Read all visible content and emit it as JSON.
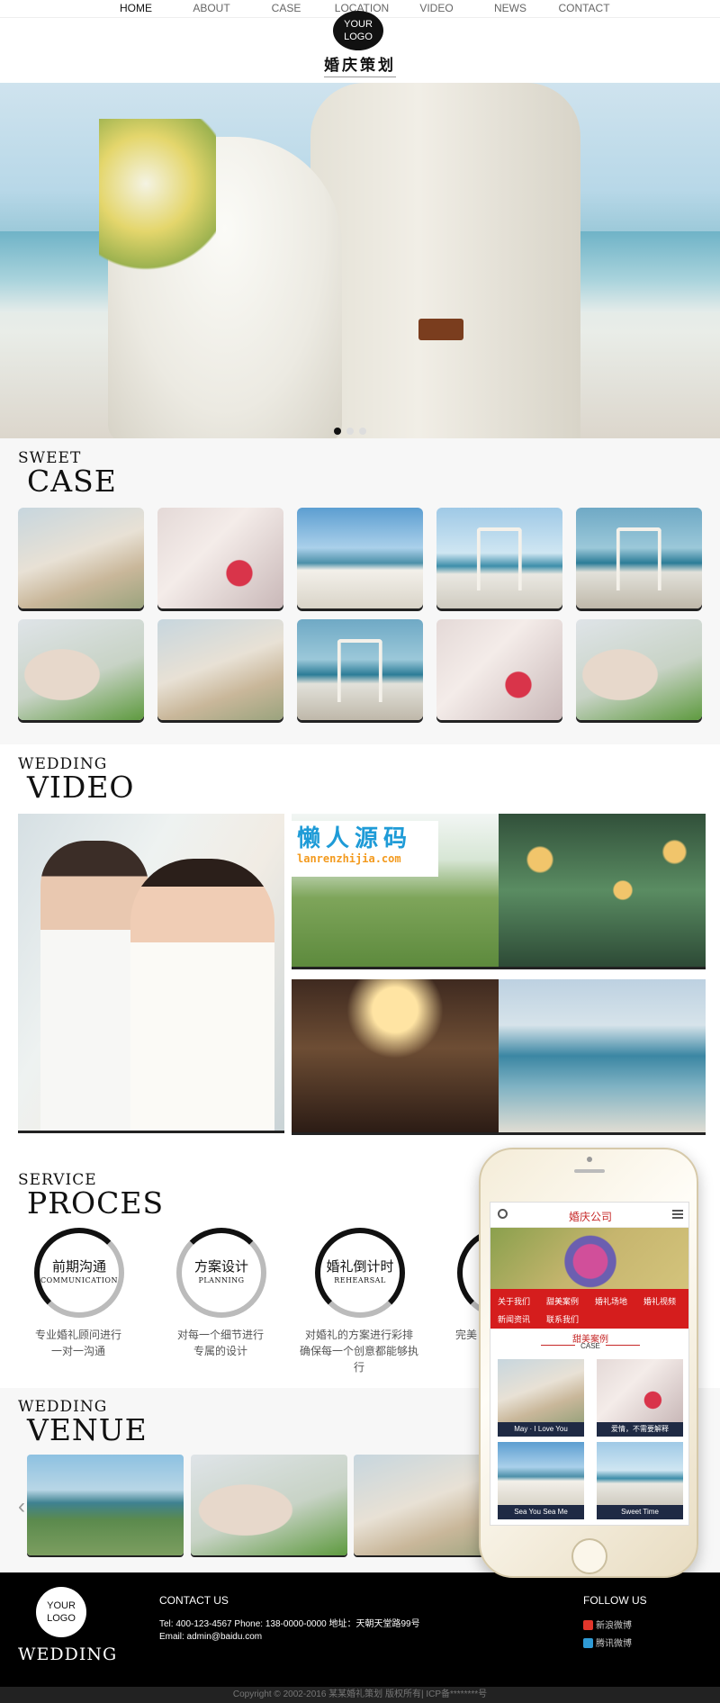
{
  "nav": {
    "items": [
      {
        "label": "HOME",
        "active": true
      },
      {
        "label": "ABOUT",
        "active": false
      },
      {
        "label": "CASE",
        "active": false
      },
      {
        "label": "LOCATION",
        "active": false
      },
      {
        "label": "VIDEO",
        "active": false
      },
      {
        "label": "NEWS",
        "active": false
      },
      {
        "label": "CONTACT",
        "active": false
      }
    ],
    "logo_line1": "YOUR",
    "logo_line2": "LOGO",
    "brand": "婚庆策划"
  },
  "hero": {
    "slides": 3,
    "active_slide": 1
  },
  "case": {
    "small": "SWEET",
    "big": "CASE"
  },
  "video": {
    "small": "WEDDING",
    "big": "VIDEO"
  },
  "watermark": {
    "line1": "懒人源码",
    "line2": "lanrenzhijia.com"
  },
  "process": {
    "small": "SERVICE",
    "big": "PROCES",
    "steps": [
      {
        "zh": "前期沟通",
        "en": "COMMUNICATION",
        "desc1": "专业婚礼顾问进行",
        "desc2": "一对一沟通",
        "desc3": ""
      },
      {
        "zh": "方案设计",
        "en": "PLANNING",
        "desc1": "对每一个细节进行",
        "desc2": "专属的设计",
        "desc3": ""
      },
      {
        "zh": "婚礼倒计时",
        "en": "REHEARSAL",
        "desc1": "对婚礼的方案进行彩排",
        "desc2": "确保每一个创意都能够执",
        "desc3": "行"
      },
      {
        "zh": "",
        "en": "",
        "desc1": "完美",
        "desc2": "",
        "desc3": ""
      }
    ]
  },
  "venue": {
    "small": "WEDDING",
    "big": "VENUE",
    "prev_arrow": "‹"
  },
  "phone": {
    "title": "婚庆公司",
    "menu": [
      "关于我们",
      "甜美案例",
      "婚礼场地",
      "婚礼视频",
      "新闻资讯",
      "联系我们"
    ],
    "section_title": "甜美案例",
    "section_sub": "CASE",
    "cards": [
      "May · I Love You",
      "爱情，不需要解释",
      "Sea You Sea Me",
      "Sweet Time"
    ]
  },
  "footer": {
    "logo_line1": "YOUR",
    "logo_line2": "LOGO",
    "brand": "WEDDING",
    "contact_title": "CONTACT US",
    "tel_line": "Tel: 400-123-4567  Phone: 138-0000-0000  地址：天朝天堂路99号",
    "email_line": "Email: admin@baidu.com",
    "follow_title": "FOLLOW US",
    "social": [
      {
        "label": "新浪微博",
        "color": "#e2362b"
      },
      {
        "label": "腾讯微博",
        "color": "#2f9bd6"
      }
    ],
    "copyright": "Copyright © 2002-2016 某某婚礼策划 版权所有|    ICP备********号"
  }
}
